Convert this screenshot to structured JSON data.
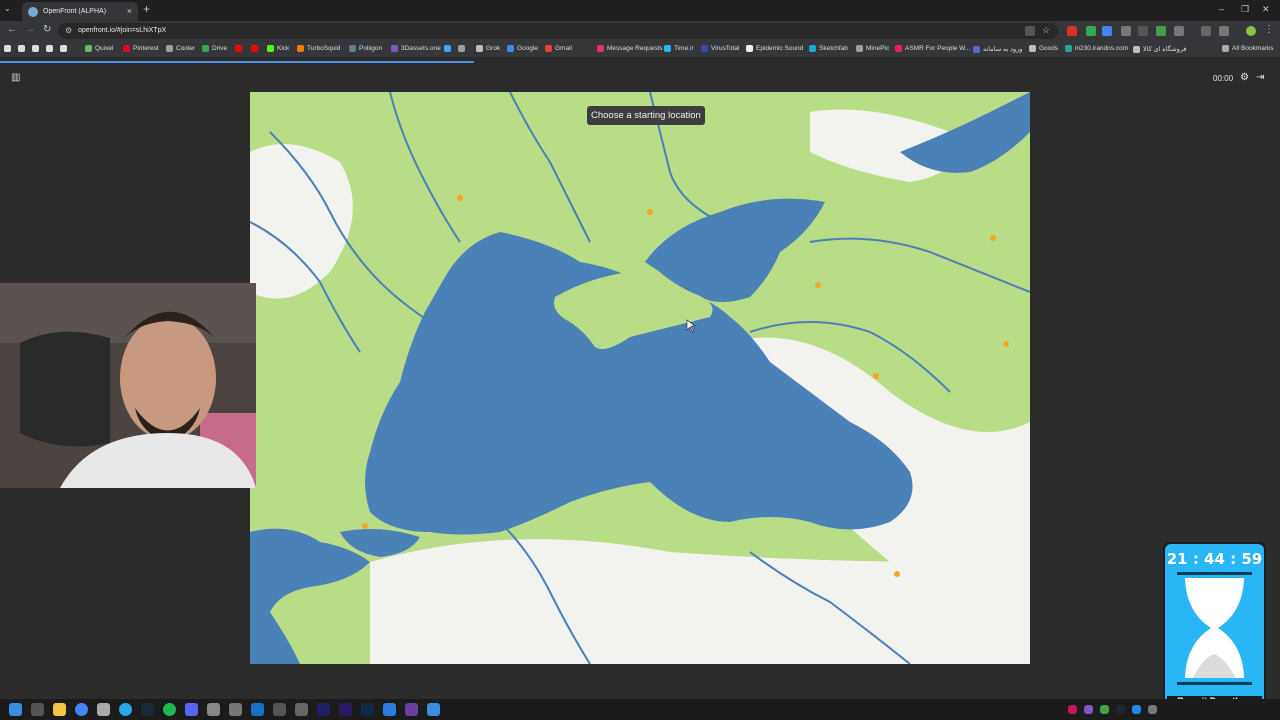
{
  "browser": {
    "tab_title": "OpenFront (ALPHA)",
    "url": "openfront.io/#join=sLhiXTpX",
    "bookmarks": [
      {
        "label": "Quixel",
        "color": "#66bb6a"
      },
      {
        "label": "Pinterest",
        "color": "#e60023"
      },
      {
        "label": "Cooler",
        "color": "#9e9e9e"
      },
      {
        "label": "Drive",
        "color": "#34a853"
      },
      {
        "label": "",
        "color": "#ff0000"
      },
      {
        "label": "",
        "color": "#ff0000"
      },
      {
        "label": "Kick",
        "color": "#53fc18"
      },
      {
        "label": "TurboSquid",
        "color": "#f57c00"
      },
      {
        "label": "Poliigon",
        "color": "#607d8b"
      },
      {
        "label": "3Dassets.one",
        "color": "#7e57c2"
      },
      {
        "label": "",
        "color": "#42a5f5"
      },
      {
        "label": "",
        "color": "#9e9e9e"
      },
      {
        "label": "Grok",
        "color": "#bdbdbd"
      },
      {
        "label": "Google",
        "color": "#4285f4"
      },
      {
        "label": "Gmail",
        "color": "#ea4335"
      },
      {
        "label": "Message Requests",
        "color": "#e1306c"
      },
      {
        "label": "Time.ir",
        "color": "#29b6f6"
      },
      {
        "label": "VirusTotal",
        "color": "#3949ab"
      },
      {
        "label": "Epidemic Sound",
        "color": "#eeeeee"
      },
      {
        "label": "Sketchfab",
        "color": "#1caad9"
      },
      {
        "label": "MinePic",
        "color": "#9e9e9e"
      },
      {
        "label": "ASMR For People W...",
        "color": "#e91e63"
      },
      {
        "label": "ورود به سامانه",
        "color": "#5c6bc0"
      },
      {
        "label": "Goods",
        "color": "#bdbdbd"
      },
      {
        "label": "ln230.irandns.com",
        "color": "#26a69a"
      },
      {
        "label": "فروشگاه ای کالا",
        "color": "#bdbdbd"
      }
    ],
    "all_bookmarks": "All Bookmarks",
    "load_progress": 0.37
  },
  "game": {
    "timer": "00:00",
    "prompt": "Choose a starting location"
  },
  "overlay": {
    "clock": "21 : 44 : 59",
    "donor_name": "Reymit Donathon"
  },
  "colors": {
    "sea": "#4a82b8",
    "land": "#b9dc87",
    "mountain": "#f2f2ee",
    "river": "#4a82b8"
  }
}
